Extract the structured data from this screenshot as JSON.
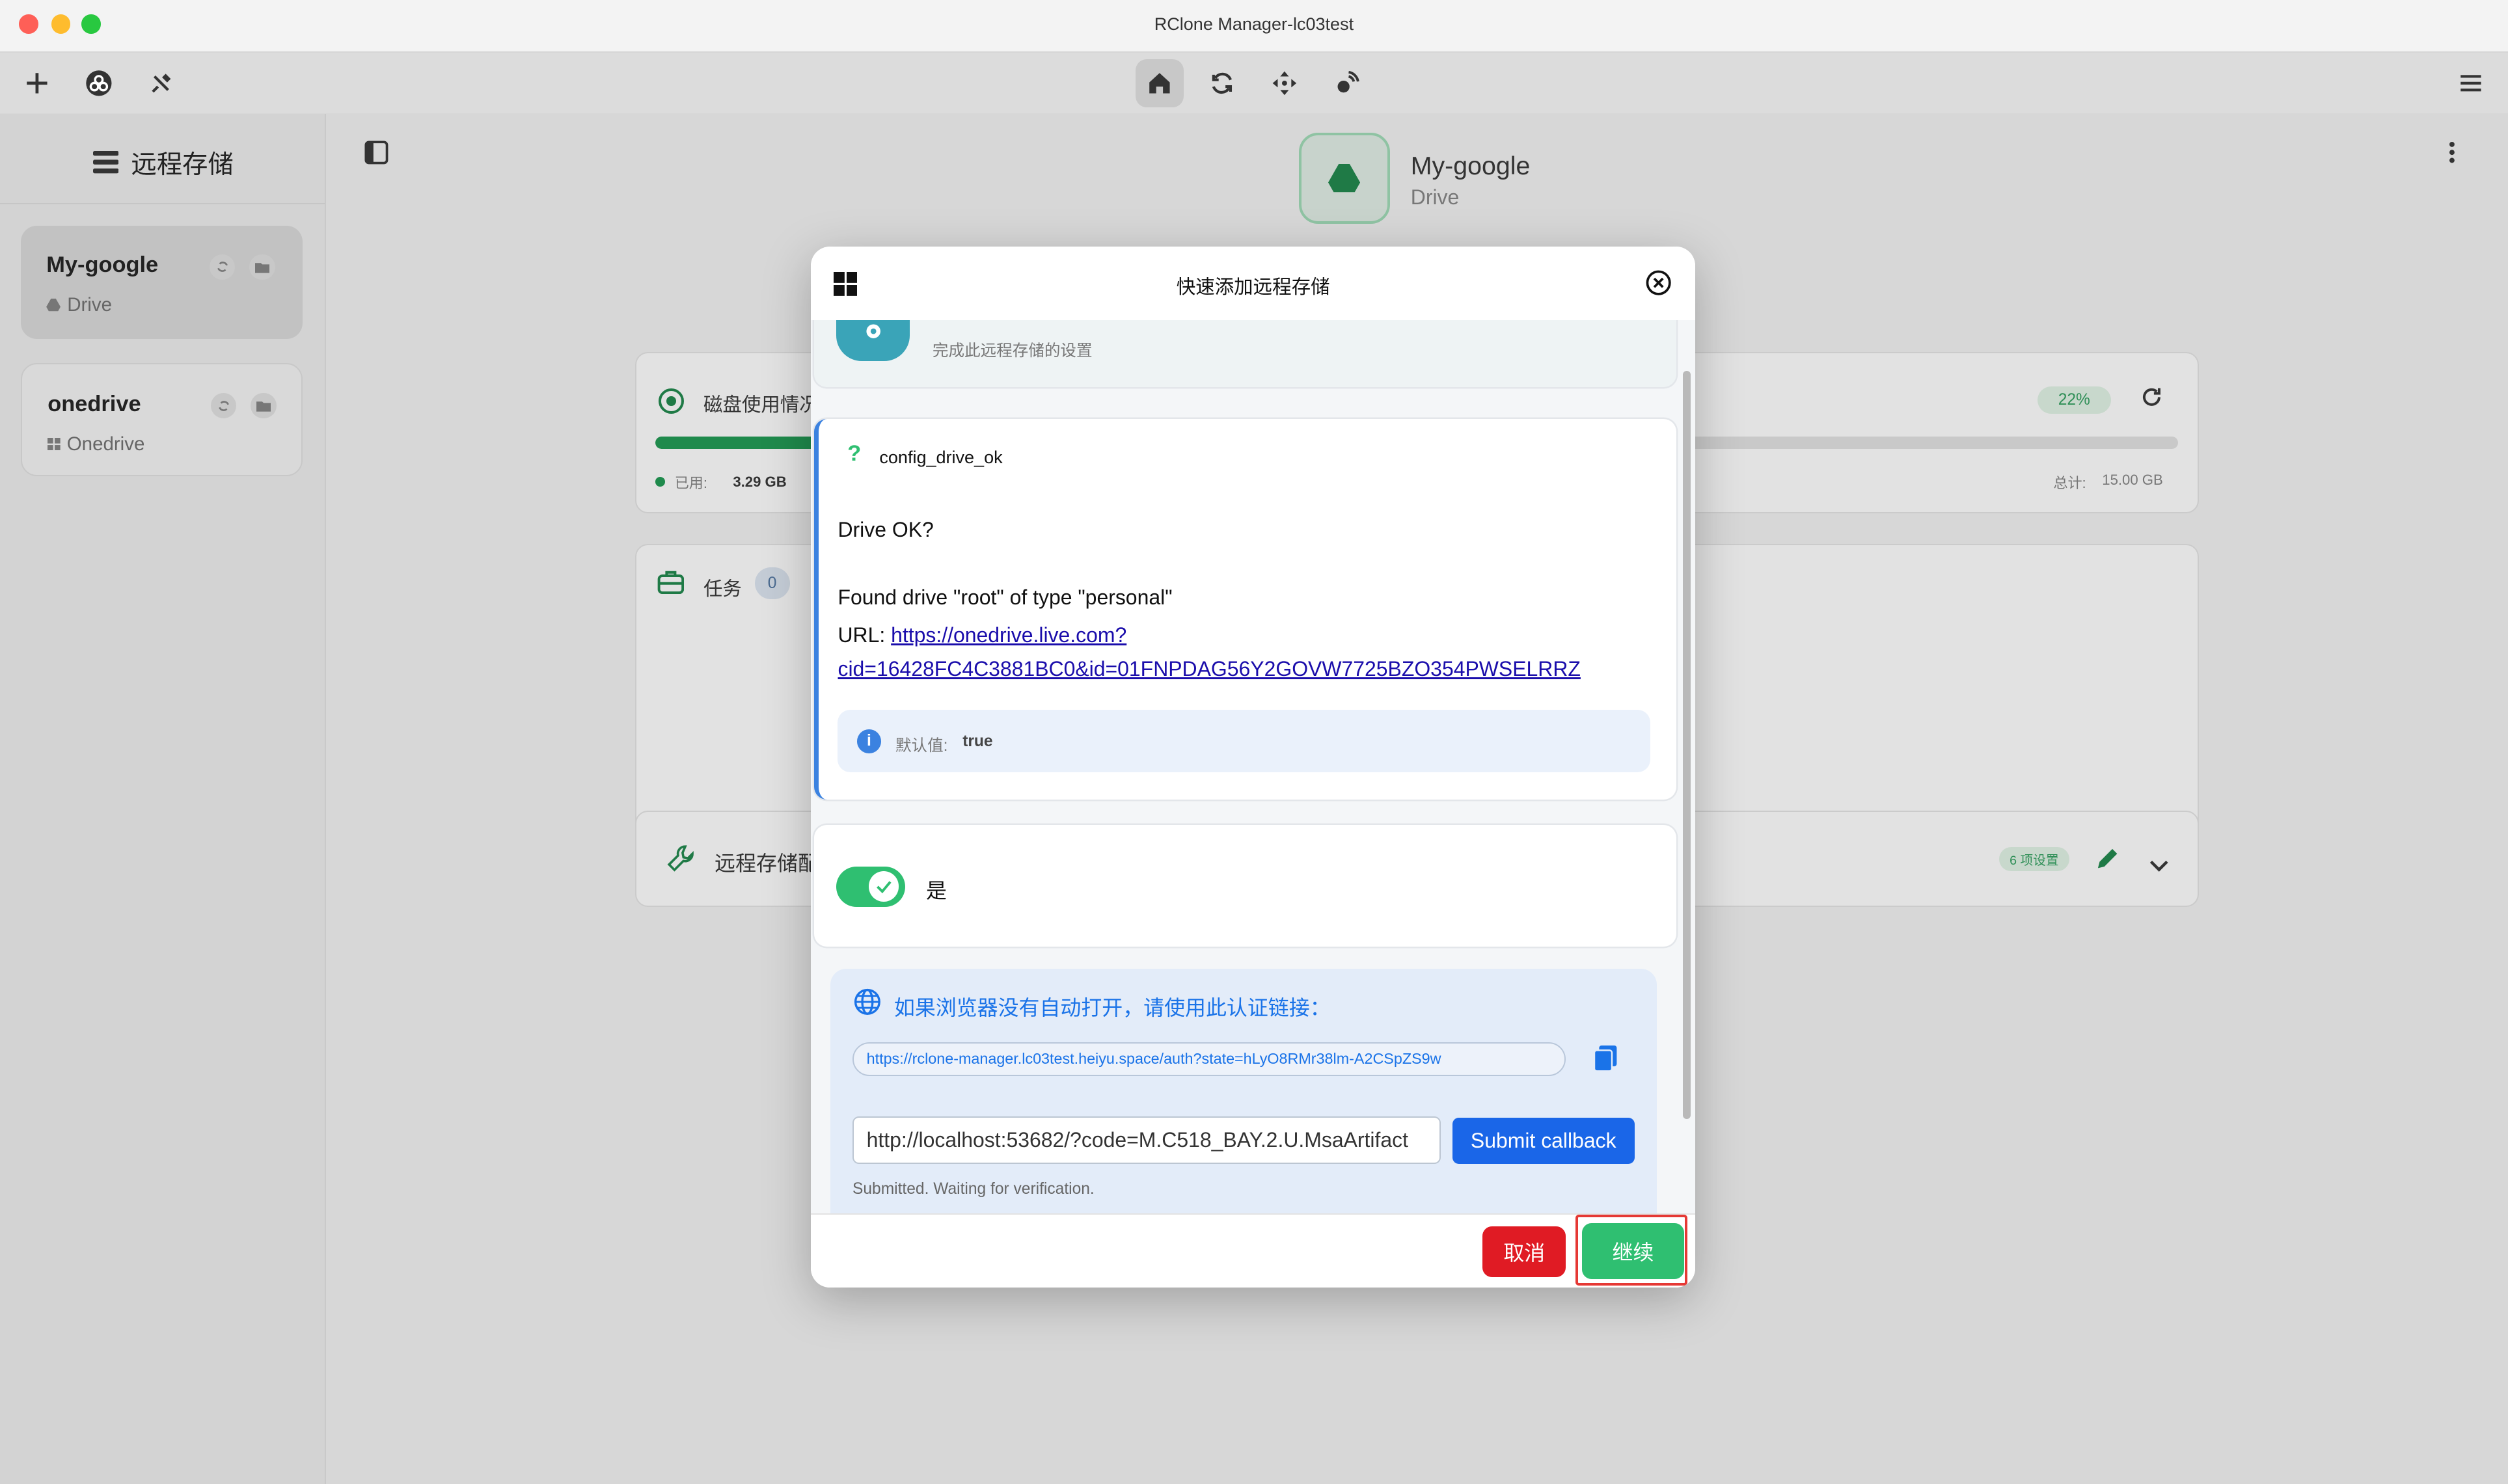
{
  "window": {
    "title": "RClone Manager-lc03test"
  },
  "sidebar": {
    "title": "远程存储",
    "remotes": [
      {
        "name": "My-google",
        "type": "Drive"
      },
      {
        "name": "onedrive",
        "type": "Onedrive"
      }
    ]
  },
  "header": {
    "remote_name": "My-google",
    "remote_type": "Drive"
  },
  "disk": {
    "title": "磁盘使用情况",
    "percent_label": "22%",
    "percent": 22,
    "used_label": "已用:",
    "used_value": "3.29 GB",
    "total_label": "总计:",
    "total_value": "15.00 GB"
  },
  "tasks": {
    "title": "任务",
    "count": "0"
  },
  "config_panel": {
    "title": "远程存储配",
    "badge": "6 项设置"
  },
  "modal": {
    "title": "快速添加远程存储",
    "step_subtitle": "完成此远程存储的设置",
    "question": {
      "key": "config_drive_ok",
      "line1": "Drive OK?",
      "line2": "Found drive \"root\" of type \"personal\"",
      "url_prefix": "URL: ",
      "url_line1": "https://onedrive.live.com?",
      "url_line2": "cid=16428FC4C3881BC0&id=01FNPDAG56Y2GOVW7725BZO354PWSELRRZ",
      "default_label": "默认值:",
      "default_value": "true"
    },
    "toggle": {
      "label": "是",
      "checked": true
    },
    "auth": {
      "title": "如果浏览器没有自动打开，请使用此认证链接：",
      "url": "https://rclone-manager.lc03test.heiyu.space/auth?state=hLyO8RMr38lm-A2CSpZS9w",
      "callback_value": "http://localhost:53682/?code=M.C518_BAY.2.U.MsaArtifact",
      "submit_label": "Submit callback",
      "status": "Submitted. Waiting for verification."
    },
    "cancel_label": "取消",
    "continue_label": "继续"
  },
  "colors": {
    "accent": "#2fbf71",
    "danger": "#e01b24",
    "primary": "#1a73e8"
  }
}
